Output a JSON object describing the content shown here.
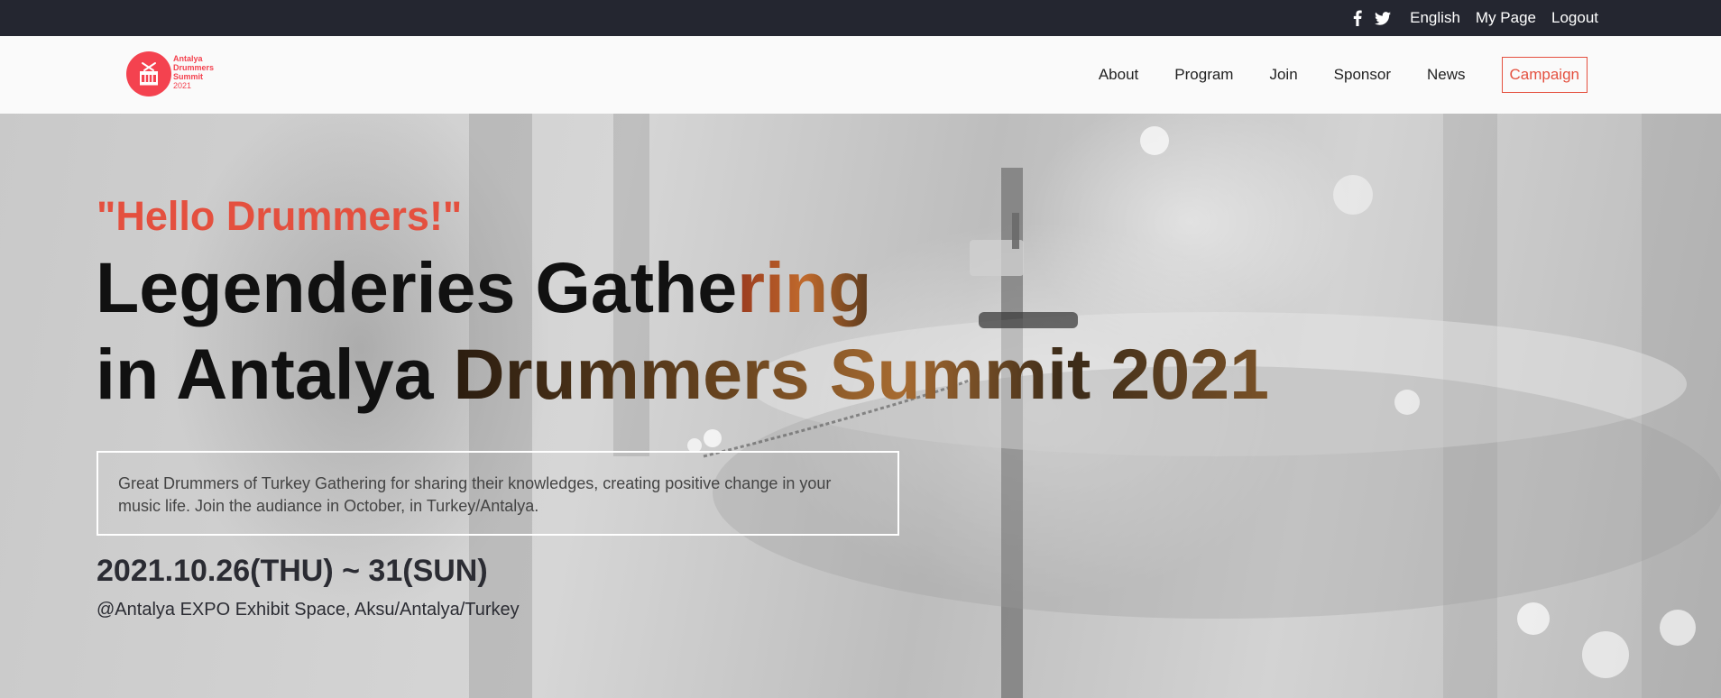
{
  "topbar": {
    "social": [
      {
        "icon": "facebook-icon"
      },
      {
        "icon": "twitter-icon"
      }
    ],
    "links": [
      "English",
      "My Page",
      "Logout"
    ]
  },
  "header": {
    "logo": {
      "line1": "Antalya",
      "line2": "Drummers",
      "line3": "Summit",
      "year": "2021",
      "color": "#f4424f"
    },
    "nav": [
      "About",
      "Program",
      "Join",
      "Sponsor",
      "News"
    ],
    "campaign": "Campaign",
    "accent": "#e4503f"
  },
  "hero": {
    "greeting": "\"Hello Drummers!\"",
    "headline_l1_a": "Legenderies Gathe",
    "headline_l1_b": "ring",
    "headline_l2_a": "in Antalya ",
    "headline_l2_b": "Drummers Summit 2021",
    "description": "Great Drummers of Turkey Gathering for sharing their knowledges, creating positive change in your music life. Join the audiance in October, in Turkey/Antalya.",
    "date": "2021.10.26(THU) ~ 31(SUN)",
    "venue": "@Antalya EXPO Exhibit Space, Aksu/Antalya/Turkey"
  }
}
